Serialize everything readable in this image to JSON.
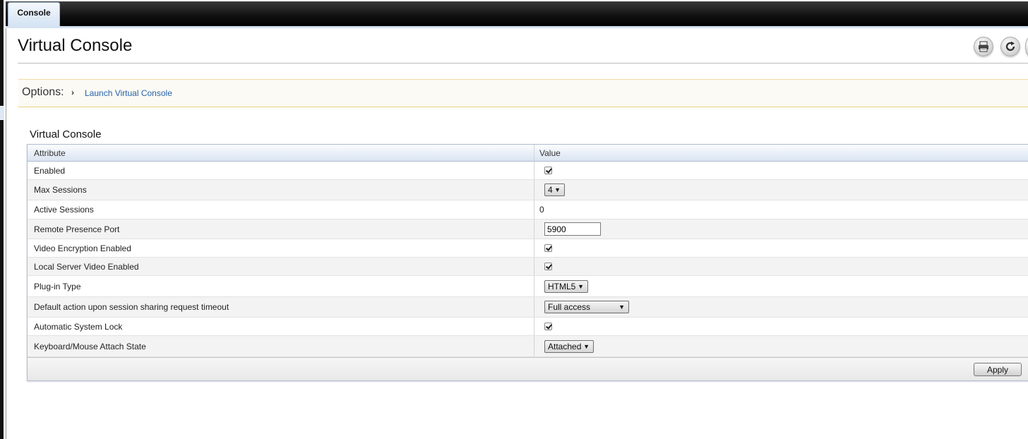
{
  "tabs": {
    "active": "Console"
  },
  "page": {
    "title": "Virtual Console"
  },
  "options": {
    "label": "Options:",
    "chevron": "›",
    "link": "Launch Virtual Console"
  },
  "section": {
    "title": "Virtual Console"
  },
  "table": {
    "headers": {
      "attribute": "Attribute",
      "value": "Value"
    },
    "rows": [
      {
        "attribute": "Enabled",
        "type": "checkbox",
        "checked": true
      },
      {
        "attribute": "Max Sessions",
        "type": "select",
        "value": "4"
      },
      {
        "attribute": "Active Sessions",
        "type": "text",
        "value": "0"
      },
      {
        "attribute": "Remote Presence Port",
        "type": "input",
        "value": "5900"
      },
      {
        "attribute": "Video Encryption Enabled",
        "type": "checkbox",
        "checked": true
      },
      {
        "attribute": "Local Server Video Enabled",
        "type": "checkbox",
        "checked": true
      },
      {
        "attribute": "Plug-in Type",
        "type": "select",
        "value": "HTML5"
      },
      {
        "attribute": "Default action upon session sharing request timeout",
        "type": "select",
        "value": "Full access"
      },
      {
        "attribute": "Automatic System Lock",
        "type": "checkbox",
        "checked": true
      },
      {
        "attribute": "Keyboard/Mouse Attach State",
        "type": "select",
        "value": "Attached"
      }
    ]
  },
  "footer": {
    "apply_label": "Apply"
  },
  "icons": {
    "print": "printer-icon",
    "refresh": "refresh-icon"
  },
  "colors": {
    "link": "#2563a8",
    "options_border": "#e8cf88",
    "grid_header": "#d9e4f2"
  }
}
